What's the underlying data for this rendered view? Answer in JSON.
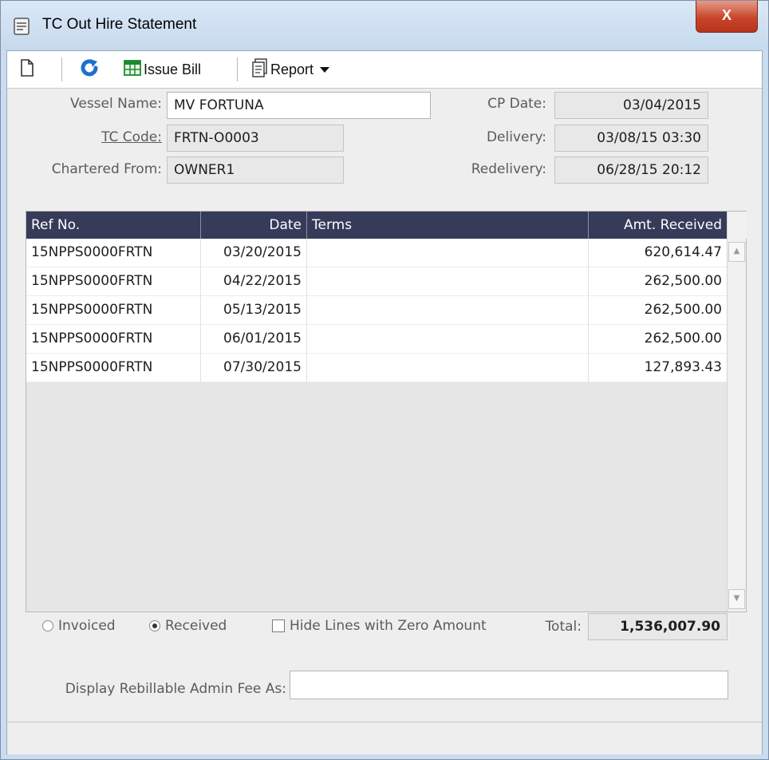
{
  "window": {
    "title": "TC Out Hire Statement",
    "close_label": "X"
  },
  "toolbar": {
    "issue_bill_label": "Issue Bill",
    "report_label": "Report"
  },
  "form": {
    "vessel_name_label": "Vessel Name:",
    "vessel_name_value": "MV FORTUNA",
    "tc_code_label": "TC Code:",
    "tc_code_value": "FRTN-O0003",
    "chartered_from_label": "Chartered From:",
    "chartered_from_value": "OWNER1",
    "cp_date_label": "CP Date:",
    "cp_date_value": "03/04/2015",
    "delivery_label": "Delivery:",
    "delivery_value": "03/08/15 03:30",
    "redelivery_label": "Redelivery:",
    "redelivery_value": "06/28/15 20:12"
  },
  "grid": {
    "columns": [
      "Ref No.",
      "Date",
      "Terms",
      "Amt. Received"
    ],
    "rows": [
      {
        "ref": "15NPPS0000FRTN",
        "date": "03/20/2015",
        "terms": "",
        "amount": "620,614.47"
      },
      {
        "ref": "15NPPS0000FRTN",
        "date": "04/22/2015",
        "terms": "",
        "amount": "262,500.00"
      },
      {
        "ref": "15NPPS0000FRTN",
        "date": "05/13/2015",
        "terms": "",
        "amount": "262,500.00"
      },
      {
        "ref": "15NPPS0000FRTN",
        "date": "06/01/2015",
        "terms": "",
        "amount": "262,500.00"
      },
      {
        "ref": "15NPPS0000FRTN",
        "date": "07/30/2015",
        "terms": "",
        "amount": "127,893.43"
      }
    ]
  },
  "footer": {
    "invoiced_label": "Invoiced",
    "received_label": "Received",
    "selected_mode": "Received",
    "hide_zero_label": "Hide Lines with Zero Amount",
    "total_label": "Total:",
    "total_value": "1,536,007.90",
    "admin_fee_label": "Display Rebillable Admin Fee As:",
    "admin_fee_value": ""
  },
  "colors": {
    "grid_header": "#363b59",
    "window_frame": "#c9dcf0",
    "close_button": "#c7462a"
  }
}
